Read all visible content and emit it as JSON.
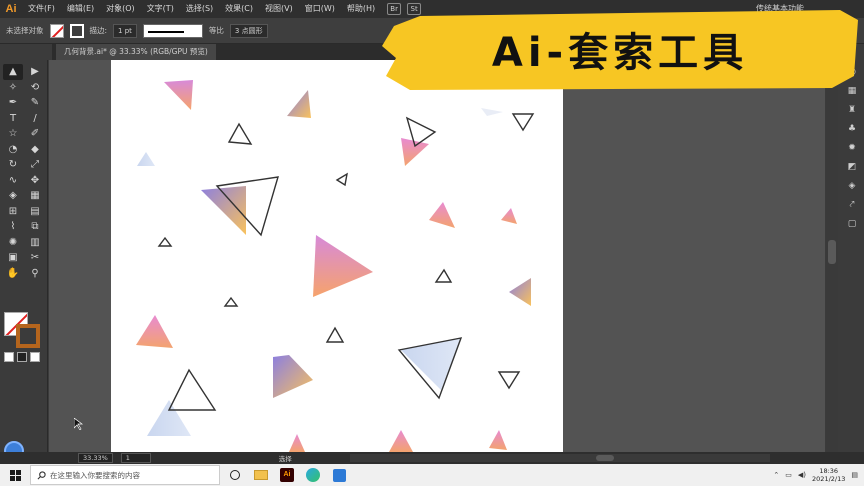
{
  "app": {
    "logo": "Ai",
    "menus": [
      "文件(F)",
      "编辑(E)",
      "对象(O)",
      "文字(T)",
      "选择(S)",
      "效果(C)",
      "视图(V)",
      "窗口(W)",
      "帮助(H)"
    ],
    "br_icon": "Br",
    "st_icon": "St",
    "workspace_label": "传统基本功能"
  },
  "control_bar": {
    "selection_label": "未选择对象",
    "stroke_label": "描边:",
    "stroke_weight": "1 pt",
    "profile_label": "等比",
    "brush_label": "3 点圆形",
    "fill_color": "none",
    "stroke_color": "#ffffff"
  },
  "document": {
    "tab_label": "几何背景.ai* @ 33.33% (RGB/GPU 预览)"
  },
  "status": {
    "zoom": "33.33%",
    "page": "1",
    "tool_label": "选择"
  },
  "taskbar": {
    "search_placeholder": "在这里输入你要搜索的内容",
    "time": "18:36",
    "date": "2021/2/13"
  },
  "banner": {
    "title": "Ai-套索工具",
    "color": "#f7c623"
  },
  "tools": [
    {
      "name": "selection-tool-icon",
      "glyph": "▲"
    },
    {
      "name": "direct-selection-tool-icon",
      "glyph": "▶"
    },
    {
      "name": "magic-wand-tool-icon",
      "glyph": "✧"
    },
    {
      "name": "lasso-tool-icon",
      "glyph": "⟲"
    },
    {
      "name": "pen-tool-icon",
      "glyph": "✒"
    },
    {
      "name": "curvature-tool-icon",
      "glyph": "✎"
    },
    {
      "name": "type-tool-icon",
      "glyph": "T"
    },
    {
      "name": "line-tool-icon",
      "glyph": "/"
    },
    {
      "name": "rectangle-tool-icon",
      "glyph": "☆"
    },
    {
      "name": "paintbrush-tool-icon",
      "glyph": "✐"
    },
    {
      "name": "shaper-tool-icon",
      "glyph": "◔"
    },
    {
      "name": "eraser-tool-icon",
      "glyph": "◆"
    },
    {
      "name": "rotate-tool-icon",
      "glyph": "↻"
    },
    {
      "name": "scale-tool-icon",
      "glyph": "⤢"
    },
    {
      "name": "warp-tool-icon",
      "glyph": "∿"
    },
    {
      "name": "free-transform-tool-icon",
      "glyph": "✥"
    },
    {
      "name": "shape-builder-tool-icon",
      "glyph": "◈"
    },
    {
      "name": "perspective-grid-tool-icon",
      "glyph": "▦"
    },
    {
      "name": "mesh-tool-icon",
      "glyph": "⊞"
    },
    {
      "name": "gradient-tool-icon",
      "glyph": "▤"
    },
    {
      "name": "eyedropper-tool-icon",
      "glyph": "⌇"
    },
    {
      "name": "blend-tool-icon",
      "glyph": "⧉"
    },
    {
      "name": "symbol-sprayer-tool-icon",
      "glyph": "✺"
    },
    {
      "name": "column-graph-tool-icon",
      "glyph": "▥"
    },
    {
      "name": "artboard-tool-icon",
      "glyph": "▣"
    },
    {
      "name": "slice-tool-icon",
      "glyph": "✂"
    },
    {
      "name": "hand-tool-icon",
      "glyph": "✋"
    },
    {
      "name": "zoom-tool-icon",
      "glyph": "⚲"
    }
  ],
  "right_panel_icons": [
    "color-panel-icon",
    "swatches-panel-icon",
    "brushes-panel-icon",
    "symbols-panel-icon",
    "appearance-panel-icon",
    "graphic-styles-panel-icon",
    "layers-panel-icon",
    "artboards-panel-icon",
    "links-panel-icon"
  ]
}
